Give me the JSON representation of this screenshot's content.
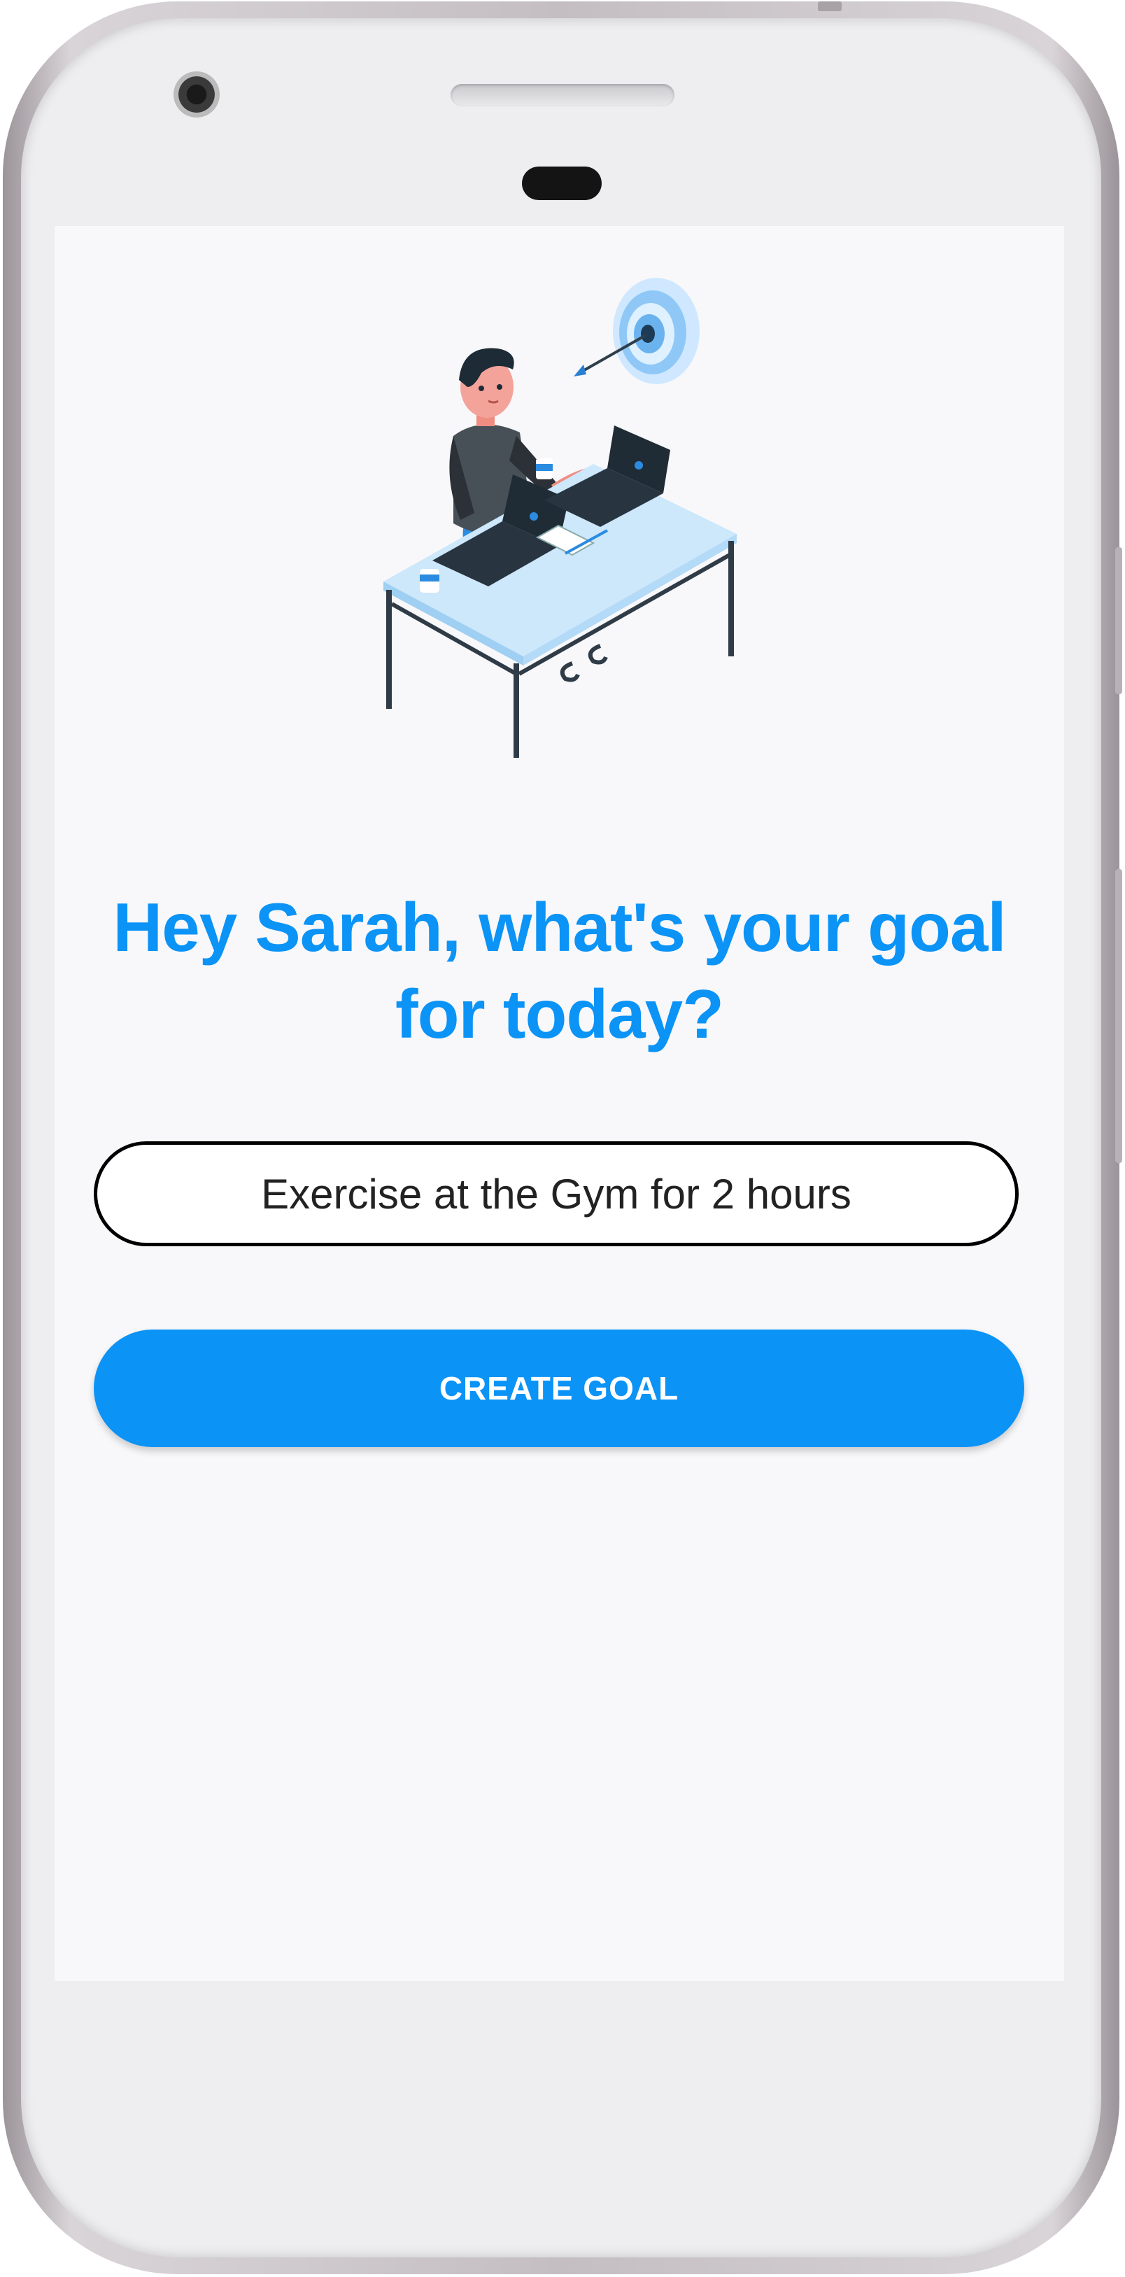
{
  "screen": {
    "headline": "Hey Sarah, what's your goal for today?",
    "goal_input": {
      "value": "Exercise at the Gym for 2 hours",
      "placeholder": ""
    },
    "create_button_label": "CREATE GOAL"
  },
  "illustration": {
    "icon": "person-at-desk-with-target-illustration"
  },
  "colors": {
    "accent": "#0b93f6",
    "screen_background": "#f8f8fa",
    "button_text": "#ffffff"
  }
}
